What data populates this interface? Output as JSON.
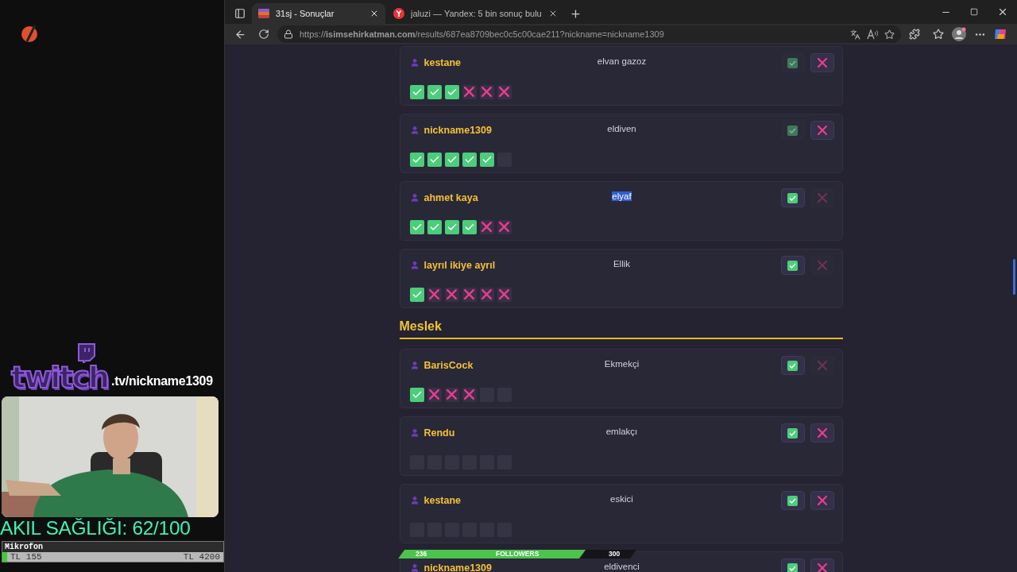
{
  "overlay": {
    "logo_text": "twitch",
    "channel": ".tv/nickname1309",
    "sanity": "AKIL SAĞLIĞI: 62/100",
    "mic": {
      "label": "Mikrofon",
      "min": "TL 155",
      "max": "TL 4200",
      "level": 0.02
    }
  },
  "browser": {
    "tabs": [
      {
        "title": "31sj - Sonuçlar",
        "selected": true
      },
      {
        "title": "jaluzi — Yandex: 5 bin sonuç bulu",
        "selected": false
      }
    ],
    "url": "https://**isimsehirkatman.com**/results/687ea8709bec0c5c00cae211?nickname=nickname1309"
  },
  "sections": [
    {
      "cards": [
        {
          "name": "kestane",
          "word": "elvan gazoz",
          "highlighted": false,
          "approve_active": false,
          "reject_active": true,
          "marks": [
            {
              "kind": "correct"
            },
            {
              "kind": "correct"
            },
            {
              "kind": "correct"
            },
            {
              "kind": "wrong"
            },
            {
              "kind": "wrong"
            },
            {
              "kind": "wrong"
            }
          ]
        },
        {
          "name": "nickname1309",
          "word": "eldiven",
          "highlighted": false,
          "approve_active": false,
          "reject_active": true,
          "marks": [
            {
              "kind": "correct"
            },
            {
              "kind": "correct"
            },
            {
              "kind": "correct"
            },
            {
              "kind": "correct"
            },
            {
              "kind": "correct"
            },
            {
              "kind": "empty"
            }
          ]
        },
        {
          "name": "ahmet kaya",
          "word": "elyaf",
          "highlighted": true,
          "approve_active": true,
          "reject_active": false,
          "marks": [
            {
              "kind": "correct"
            },
            {
              "kind": "correct"
            },
            {
              "kind": "correct"
            },
            {
              "kind": "correct"
            },
            {
              "kind": "wrong"
            },
            {
              "kind": "wrong"
            }
          ]
        },
        {
          "name": "layrıl ikiye ayrıl",
          "word": "Ellik",
          "highlighted": false,
          "approve_active": true,
          "reject_active": false,
          "marks": [
            {
              "kind": "correct"
            },
            {
              "kind": "wrong"
            },
            {
              "kind": "wrong"
            },
            {
              "kind": "wrong"
            },
            {
              "kind": "wrong"
            },
            {
              "kind": "wrong"
            }
          ]
        }
      ]
    },
    {
      "title": "Meslek",
      "cards": [
        {
          "name": "BarisCock",
          "word": "Ekmekçi",
          "highlighted": false,
          "approve_active": true,
          "reject_active": false,
          "marks": [
            {
              "kind": "correct"
            },
            {
              "kind": "wrong"
            },
            {
              "kind": "wrong"
            },
            {
              "kind": "wrong"
            },
            {
              "kind": "empty"
            },
            {
              "kind": "empty"
            }
          ]
        },
        {
          "name": "Rendu",
          "word": "emlakçı",
          "highlighted": false,
          "approve_active": true,
          "reject_active": true,
          "marks": [
            {
              "kind": "empty"
            },
            {
              "kind": "empty"
            },
            {
              "kind": "empty"
            },
            {
              "kind": "empty"
            },
            {
              "kind": "empty"
            },
            {
              "kind": "empty"
            }
          ]
        },
        {
          "name": "kestane",
          "word": "eskici",
          "highlighted": false,
          "approve_active": true,
          "reject_active": true,
          "marks": [
            {
              "kind": "empty"
            },
            {
              "kind": "empty"
            },
            {
              "kind": "empty"
            },
            {
              "kind": "empty"
            },
            {
              "kind": "empty"
            },
            {
              "kind": "empty"
            }
          ]
        },
        {
          "name": "nickname1309",
          "word": "eldivenci",
          "highlighted": false,
          "approve_active": true,
          "reject_active": true
        }
      ]
    }
  ],
  "followers": {
    "current": "236",
    "label": "FOLLOWERS",
    "goal": "300",
    "level": 0.787
  }
}
